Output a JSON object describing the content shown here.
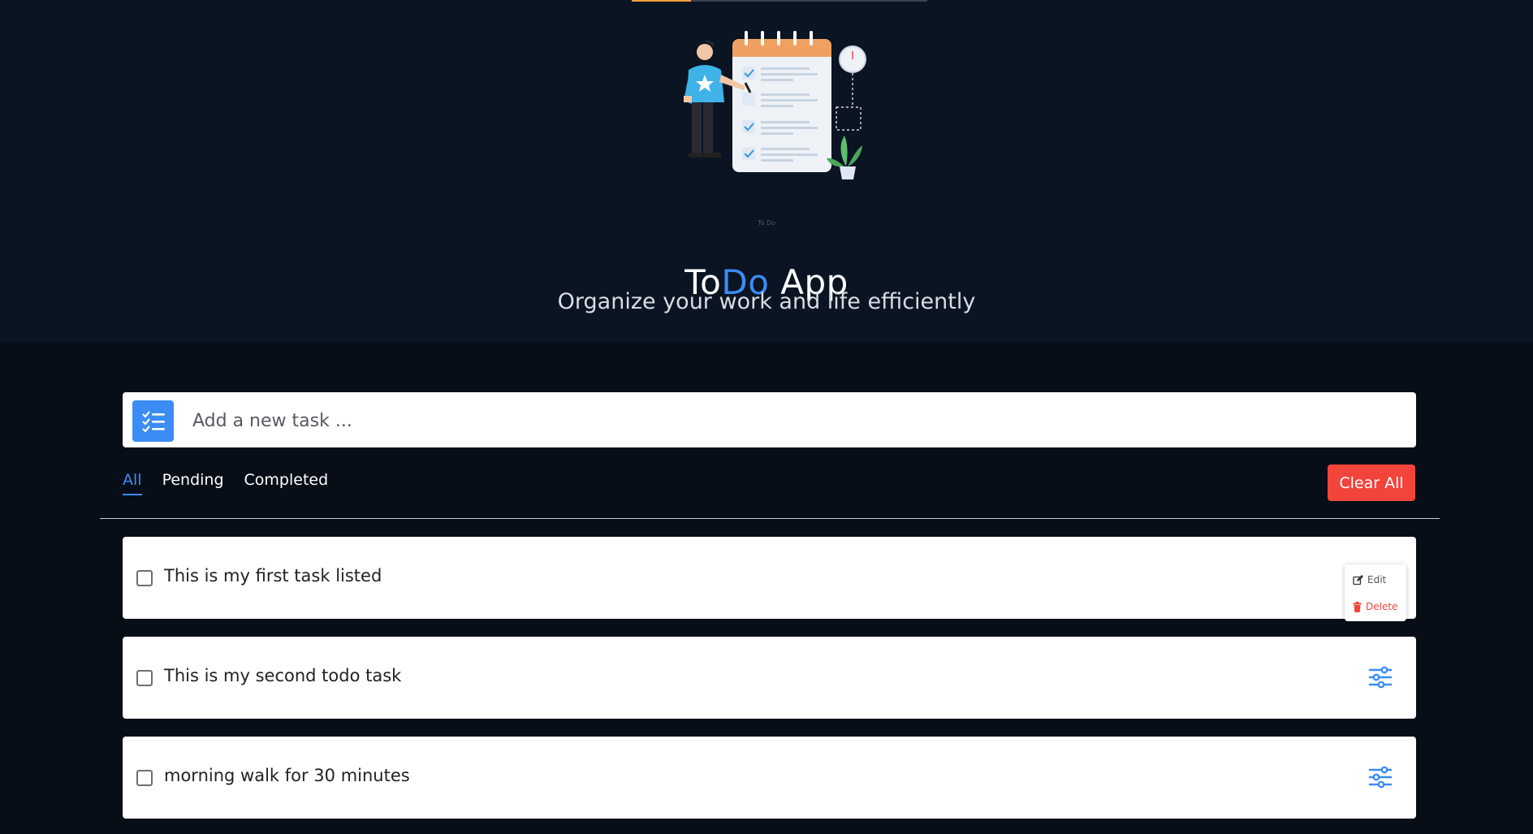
{
  "header": {
    "illustration_caption": "To Do",
    "title_part1": "To",
    "title_part2": "Do",
    "title_part3": " App",
    "subtitle": "Organize your work and life efficiently",
    "progress_fraction": 0.2,
    "accent_color": "#3b8cf5"
  },
  "task_input": {
    "placeholder": "Add a new task ...",
    "value": "",
    "icon": "list-check-icon"
  },
  "filters": {
    "tabs": [
      {
        "label": "All",
        "active": true
      },
      {
        "label": "Pending",
        "active": false
      },
      {
        "label": "Completed",
        "active": false
      }
    ],
    "clear_label": "Clear All",
    "clear_color": "#f2443a"
  },
  "tasks": [
    {
      "text": "This is my first task listed",
      "checked": false,
      "menu_open": true
    },
    {
      "text": "This is my second todo task",
      "checked": false,
      "menu_open": false
    },
    {
      "text": "morning walk for 30 minutes",
      "checked": false,
      "menu_open": false
    }
  ],
  "task_menu": {
    "edit_label": "Edit",
    "delete_label": "Delete",
    "edit_icon": "edit-icon",
    "delete_icon": "trash-icon"
  }
}
